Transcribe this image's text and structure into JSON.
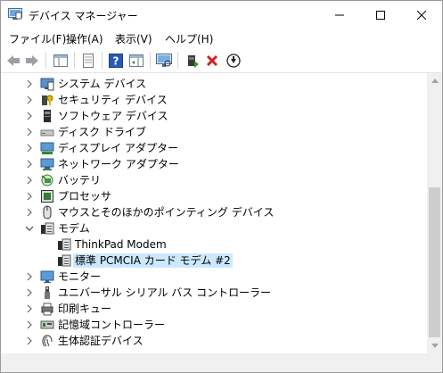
{
  "window": {
    "title": "デバイス マネージャー",
    "accent_color": "#cce8ff"
  },
  "menu": [
    {
      "label": "ファイル(F)",
      "name": "menu-file"
    },
    {
      "label": "操作(A)",
      "name": "menu-action"
    },
    {
      "label": "表示(V)",
      "name": "menu-view"
    },
    {
      "label": "ヘルプ(H)",
      "name": "menu-help"
    }
  ],
  "toolbar": [
    {
      "icon": "back-arrow-icon"
    },
    {
      "icon": "forward-arrow-icon"
    },
    {
      "icon": "show-hide-console-tree-icon"
    },
    {
      "icon": "properties-icon"
    },
    {
      "icon": "help-icon"
    },
    {
      "icon": "action-pane-icon"
    },
    {
      "icon": "scan-hardware-changes-icon"
    },
    {
      "icon": "update-driver-icon"
    },
    {
      "icon": "uninstall-device-icon"
    },
    {
      "icon": "disable-device-icon"
    }
  ],
  "tree": [
    {
      "label": "システム デバイス",
      "icon": "system-devices-icon",
      "state": "collapsed",
      "level": 1
    },
    {
      "label": "セキュリティ デバイス",
      "icon": "security-devices-icon",
      "state": "collapsed",
      "level": 1
    },
    {
      "label": "ソフトウェア デバイス",
      "icon": "software-devices-icon",
      "state": "collapsed",
      "level": 1
    },
    {
      "label": "ディスク ドライブ",
      "icon": "disk-drive-icon",
      "state": "collapsed",
      "level": 1
    },
    {
      "label": "ディスプレイ アダプター",
      "icon": "display-adapter-icon",
      "state": "collapsed",
      "level": 1
    },
    {
      "label": "ネットワーク アダプター",
      "icon": "network-adapter-icon",
      "state": "collapsed",
      "level": 1
    },
    {
      "label": "バッテリ",
      "icon": "battery-icon",
      "state": "collapsed",
      "level": 1
    },
    {
      "label": "プロセッサ",
      "icon": "processor-icon",
      "state": "collapsed",
      "level": 1
    },
    {
      "label": "マウスとそのほかのポインティング デバイス",
      "icon": "mouse-icon",
      "state": "collapsed",
      "level": 1
    },
    {
      "label": "モデム",
      "icon": "modem-icon",
      "state": "expanded",
      "level": 1
    },
    {
      "label": "ThinkPad Modem",
      "icon": "modem-icon",
      "state": "leaf",
      "level": 2
    },
    {
      "label": "標準 PCMCIA カード モデム #2",
      "icon": "modem-icon",
      "state": "leaf",
      "level": 2,
      "selected": true
    },
    {
      "label": "モニター",
      "icon": "monitor-icon",
      "state": "collapsed",
      "level": 1
    },
    {
      "label": "ユニバーサル シリアル バス コントローラー",
      "icon": "usb-controller-icon",
      "state": "collapsed",
      "level": 1
    },
    {
      "label": "印刷キュー",
      "icon": "print-queue-icon",
      "state": "collapsed",
      "level": 1
    },
    {
      "label": "記憶域コントローラー",
      "icon": "storage-controller-icon",
      "state": "collapsed",
      "level": 1
    },
    {
      "label": "生体認証デバイス",
      "icon": "biometric-devices-icon",
      "state": "collapsed",
      "level": 1
    }
  ]
}
